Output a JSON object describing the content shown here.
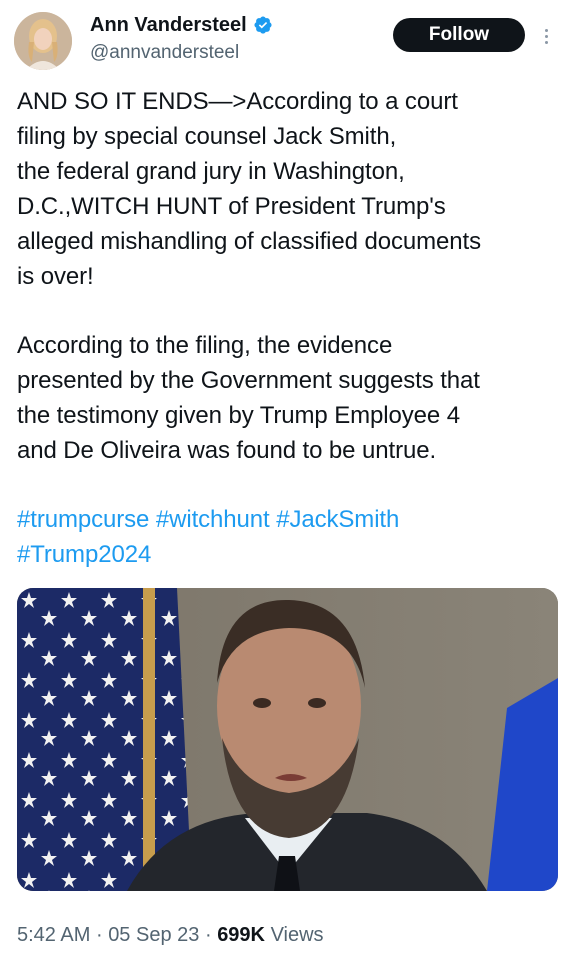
{
  "author": {
    "name": "Ann Vandersteel",
    "handle": "@annvandersteel",
    "verified": true
  },
  "actions": {
    "follow_label": "Follow"
  },
  "tweet": {
    "paragraph1": "AND SO IT ENDS—>According to a court\nfiling by special counsel Jack Smith,\nthe federal grand jury in Washington,\nD.C.,WITCH HUNT of President Trump's\nalleged mishandling of classified documents\nis over!",
    "paragraph2": "According to the filing, the evidence\npresented by the Government suggests that\nthe testimony given by Trump Employee 4\nand De Oliveira was found to be untrue.",
    "hashtags": [
      "#trumpcurse",
      "#witchhunt",
      "#JackSmith",
      "#Trump2024"
    ]
  },
  "meta": {
    "time": "5:42 AM",
    "date": "05 Sep 23",
    "views_count": "699K",
    "views_label": "Views"
  },
  "colors": {
    "link": "#1d9bf0",
    "text": "#0f1419",
    "muted": "#536471",
    "verified_badge": "#1d9bf0"
  },
  "icons": {
    "verified": "verified-badge-icon",
    "more": "more-vertical-icon"
  }
}
